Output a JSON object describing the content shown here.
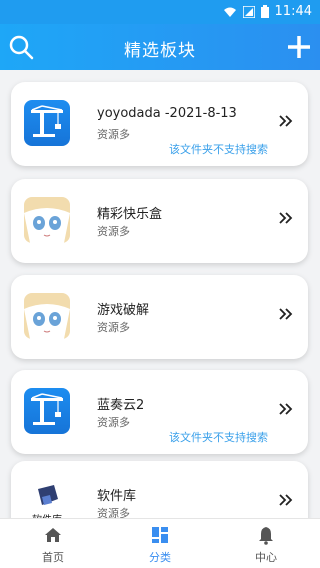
{
  "status_bar": {
    "time": "11:44"
  },
  "app_bar": {
    "title": "精选板块"
  },
  "items": [
    {
      "name": "yoyodada -2021-8-13",
      "subtitle": "资源多",
      "note": "该文件夹不支持搜索",
      "icon": "crane-app-icon"
    },
    {
      "name": "精彩快乐盒",
      "subtitle": "资源多",
      "note": "",
      "icon": "anime-avatar-icon"
    },
    {
      "name": "游戏破解",
      "subtitle": "资源多",
      "note": "",
      "icon": "anime-avatar-icon"
    },
    {
      "name": "蓝奏云2",
      "subtitle": "资源多",
      "note": "该文件夹不支持搜索",
      "icon": "crane-app-icon"
    },
    {
      "name": "软件库",
      "subtitle": "资源多",
      "note": "",
      "icon": "software-library-logo",
      "logo_text": "软件库"
    }
  ],
  "bottom_nav": {
    "home": "首页",
    "category": "分类",
    "center": "中心",
    "active": "category"
  },
  "colors": {
    "accent": "#1f9cf0",
    "note": "#3aa0ea",
    "active_nav": "#3a8ef0"
  }
}
